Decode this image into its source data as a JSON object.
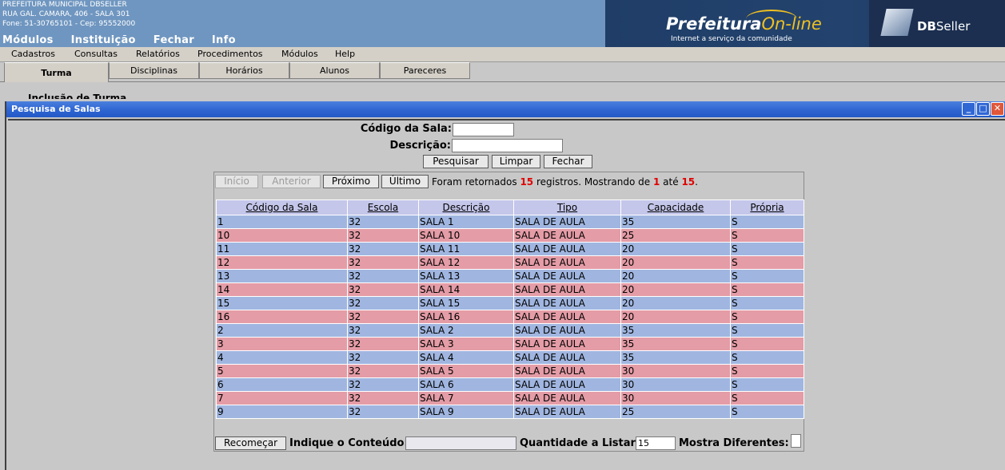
{
  "header": {
    "org_name": "PREFEITURA MUNICIPAL DBSELLER",
    "org_address": "RUA GAL. CAMARA, 406 - SALA 301",
    "org_phone": "Fone: 51-30765101  -  Cep: 95552000",
    "main_menu": [
      "Módulos",
      "Instituição",
      "Fechar",
      "Info"
    ],
    "logo_title": "Prefeitura",
    "logo_title_accent": "On-line",
    "logo_subtitle": "Internet a serviço da comunidade",
    "brand_db": "DB",
    "brand_seller": "Seller"
  },
  "submenu": [
    "Cadastros",
    "Consultas",
    "Relatórios",
    "Procedimentos",
    "Módulos",
    "Help"
  ],
  "tabs": [
    "Turma",
    "Disciplinas",
    "Horários",
    "Alunos",
    "Pareceres"
  ],
  "background_text": "Inclusão de Turma",
  "window": {
    "title": "Pesquisa de Salas",
    "buttons": {
      "minimize": "_",
      "maximize": "□",
      "close": "✕"
    }
  },
  "search": {
    "codigo_label": "Código da Sala:",
    "codigo_value": "",
    "descricao_label": "Descrição:",
    "descricao_value": "",
    "pesquisar": "Pesquisar",
    "limpar": "Limpar",
    "fechar": "Fechar"
  },
  "nav": {
    "inicio": "Início",
    "anterior": "Anterior",
    "proximo": "Próximo",
    "ultimo": "Último",
    "info_prefix": "Foram retornados",
    "total": "15",
    "info_middle": "registros. Mostrando de",
    "from": "1",
    "info_until": "até",
    "to": "15",
    "info_end": "."
  },
  "table": {
    "headers": [
      "Código da Sala",
      "Escola",
      "Descrição",
      "Tipo",
      "Capacidade",
      "Própria"
    ],
    "rows": [
      [
        "1",
        "32",
        "SALA 1",
        "SALA DE AULA",
        "35",
        "S"
      ],
      [
        "10",
        "32",
        "SALA 10",
        "SALA DE AULA",
        "25",
        "S"
      ],
      [
        "11",
        "32",
        "SALA 11",
        "SALA DE AULA",
        "20",
        "S"
      ],
      [
        "12",
        "32",
        "SALA 12",
        "SALA DE AULA",
        "20",
        "S"
      ],
      [
        "13",
        "32",
        "SALA 13",
        "SALA DE AULA",
        "20",
        "S"
      ],
      [
        "14",
        "32",
        "SALA 14",
        "SALA DE AULA",
        "20",
        "S"
      ],
      [
        "15",
        "32",
        "SALA 15",
        "SALA DE AULA",
        "20",
        "S"
      ],
      [
        "16",
        "32",
        "SALA 16",
        "SALA DE AULA",
        "20",
        "S"
      ],
      [
        "2",
        "32",
        "SALA 2",
        "SALA DE AULA",
        "35",
        "S"
      ],
      [
        "3",
        "32",
        "SALA 3",
        "SALA DE AULA",
        "35",
        "S"
      ],
      [
        "4",
        "32",
        "SALA 4",
        "SALA DE AULA",
        "35",
        "S"
      ],
      [
        "5",
        "32",
        "SALA 5",
        "SALA DE AULA",
        "30",
        "S"
      ],
      [
        "6",
        "32",
        "SALA 6",
        "SALA DE AULA",
        "30",
        "S"
      ],
      [
        "7",
        "32",
        "SALA 7",
        "SALA DE AULA",
        "30",
        "S"
      ],
      [
        "9",
        "32",
        "SALA 9",
        "SALA DE AULA",
        "25",
        "S"
      ]
    ]
  },
  "footer": {
    "recomecar": "Recomeçar",
    "indique_label": "Indique o Conteúdo:",
    "indique_value": "",
    "quantidade_label": "Quantidade a Listar:",
    "quantidade_value": "15",
    "mostra_label": "Mostra Diferentes:"
  },
  "colors": {
    "row_even": "#a0b6e0",
    "row_odd": "#e49ca6",
    "header_row": "#c4c6ea",
    "titlebar": "#2c63d0",
    "highlight": "#e00000"
  }
}
